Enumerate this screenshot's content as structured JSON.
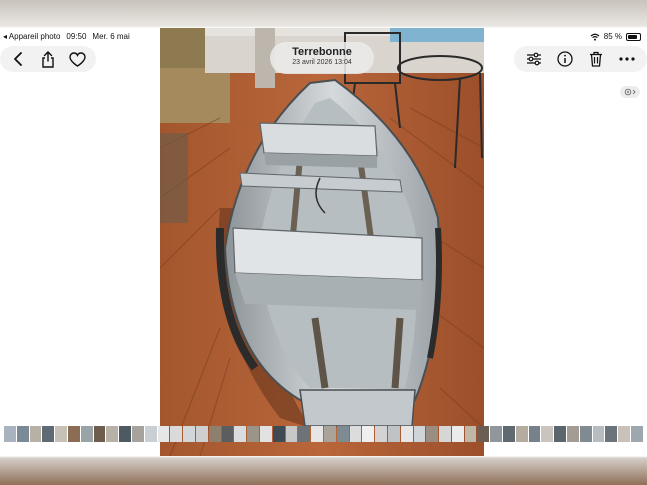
{
  "status_bar": {
    "back_app": "◂ Appareil photo",
    "time": "09:50",
    "date": "Mer. 6 mai",
    "battery": "85 %"
  },
  "photo": {
    "location_title": "Terrebonne",
    "datetime": "23 avril 2026 13:04"
  },
  "toolbar_left": {
    "icons": [
      "chevron-left-icon",
      "share-icon",
      "heart-icon"
    ]
  },
  "toolbar_right": {
    "icons": [
      "adjust-sliders-icon",
      "info-icon",
      "trash-icon",
      "more-icon"
    ]
  },
  "thumbnail_strip": {
    "colors": [
      "#a8b3bd",
      "#7a8a96",
      "#b9b0a5",
      "#5f6b74",
      "#c7c0b6",
      "#8b6d55",
      "#9aa3a8",
      "#6e5c4c",
      "#b8b1a8",
      "#4e5a61",
      "#a7a29b",
      "#c9cfd3",
      "#e6e6e6",
      "#dadada",
      "#d2d6d9",
      "#cfcfcf",
      "#8e7f6e",
      "#5b5d5f",
      "#d9dcde",
      "#9c9389",
      "#e2e2e2",
      "#3f4a52",
      "#c8c8c8",
      "#6d7379",
      "#e6e6e6",
      "#aaa39a",
      "#7e8b93",
      "#dcdcdc",
      "#efefef",
      "#d3d3d3",
      "#bfc3c6",
      "#e6e6e6",
      "#cfd4d8",
      "#9a8e80",
      "#d6d6d6",
      "#ebebeb",
      "#c1b7a9",
      "#6b5f55",
      "#8f979c",
      "#5e6a70",
      "#b4aca1",
      "#77818a",
      "#c9c4bd",
      "#5a656c",
      "#a39c92",
      "#7f8a91",
      "#b7bcc0",
      "#6a747a",
      "#c8c2ba",
      "#9ea7ad"
    ]
  }
}
